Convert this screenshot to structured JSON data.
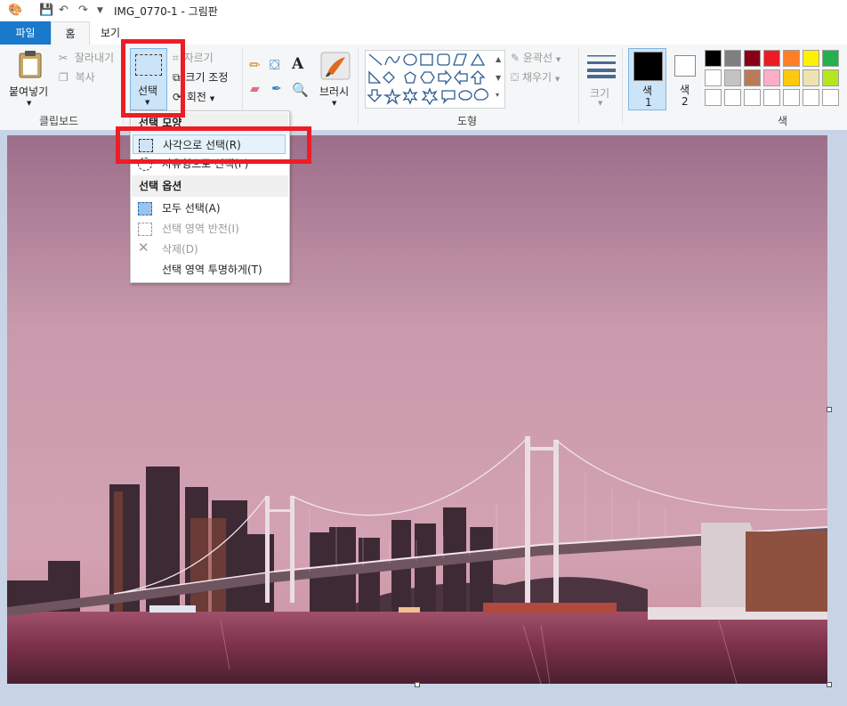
{
  "title_bar": {
    "title": "IMG_0770-1 - 그림판"
  },
  "tabs": [
    {
      "label": "파일"
    },
    {
      "label": "홈"
    },
    {
      "label": "보기"
    }
  ],
  "ribbon": {
    "clipboard": {
      "paste": "붙여넣기",
      "cut": "잘라내기",
      "copy": "복사",
      "group": "클립보드"
    },
    "image": {
      "select": "선택",
      "crop": "자르기",
      "resize": "크기 조정",
      "rotate": "회전"
    },
    "tools": {
      "brush": "브러시"
    },
    "shapes": {
      "outline": "윤곽선",
      "fill": "채우기",
      "group": "도형"
    },
    "size": {
      "label": "크기"
    },
    "colors": {
      "color1": "색",
      "color1_num": "1",
      "color2": "색",
      "color2_num": "2",
      "group": "색",
      "palette_row1": [
        "#000000",
        "#7f7f7f",
        "#880015",
        "#ed1c24",
        "#ff7f27",
        "#fff200",
        "#22b14c"
      ],
      "palette_row2": [
        "#ffffff",
        "#c3c3c3",
        "#b97a57",
        "#ffaec9",
        "#ffc90e",
        "#efe4b0",
        "#b5e61d"
      ]
    }
  },
  "dropdown": {
    "shapes_header": "선택 모양",
    "rect_select": "사각으로 선택(R)",
    "free_select": "자유형으로 선택(F)",
    "options_header": "선택 옵션",
    "select_all": "모두 선택(A)",
    "invert": "선택 영역 반전(I)",
    "delete": "삭제(D)",
    "transparent": "선택 영역 투명하게(T)"
  }
}
